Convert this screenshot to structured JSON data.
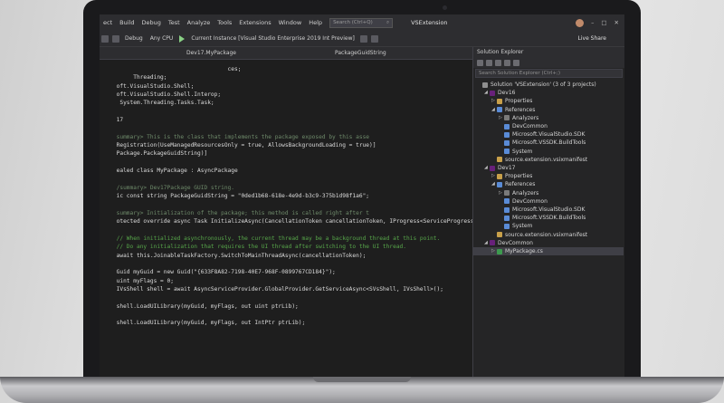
{
  "menu": {
    "items": [
      "ect",
      "Build",
      "Debug",
      "Test",
      "Analyze",
      "Tools",
      "Extensions",
      "Window",
      "Help"
    ],
    "search_placeholder": "Search (Ctrl+Q)",
    "solution_title": "VSExtension"
  },
  "toolbar": {
    "config": "Debug",
    "platform": "Any CPU",
    "run_target": "Current Instance [Visual Studio Enterprise 2019 Int Preview]",
    "live_share": "Live Share"
  },
  "editor_nav": {
    "class_dropdown": "Dev17.MyPackage",
    "member_dropdown": "PackageGuidString"
  },
  "code_lines": [
    "                                      ces;",
    "          Threading;",
    "     oft.VisualStudio.Shell;",
    "     oft.VisualStudio.Shell.Interop;",
    "      System.Threading.Tasks.Task;",
    "",
    "     17",
    "",
    "     summary> This is the class that implements the package exposed by this asse",
    "     Registration(UseManagedResourcesOnly = true, AllowsBackgroundLoading = true)]",
    "     Package.PackageGuidString)]",
    "",
    "     ealed class MyPackage : AsyncPackage",
    "",
    "     /summary> Dev17Package GUID string.",
    "     ic const string PackageGuidString = \"0ded1b68-618e-4e9d-b3c9-375b1d98f1a6\";",
    "",
    "     summary> Initialization of the package; this method is called right after t",
    "     otected override async Task InitializeAsync(CancellationToken cancellationToken, IProgress<ServiceProgressData> pr",
    "",
    "     // When initialized asynchronously, the current thread may be a background thread at this point.",
    "     // Do any initialization that requires the UI thread after switching to the UI thread.",
    "     await this.JoinableTaskFactory.SwitchToMainThreadAsync(cancellationToken);",
    "",
    "     Guid myGuid = new Guid(\"{633F8A82-7198-40E7-968F-0899767CD184}\");",
    "     uint myFlags = 0;",
    "     IVsShell shell = await AsyncServiceProvider.GlobalProvider.GetServiceAsync<SVsShell, IVsShell>();",
    "",
    "     shell.LoadUILibrary(myGuid, myFlags, out uint ptrLib);",
    "",
    "     shell.LoadUILibrary(myGuid, myFlags, out IntPtr ptrLib);"
  ],
  "explorer": {
    "title": "Solution Explorer",
    "search_placeholder": "Search Solution Explorer (Ctrl+;)",
    "nodes": [
      {
        "label": "Solution 'VSExtension' (3 of 3 projects)",
        "depth": 0,
        "arrow": "",
        "color": "#8f8f8f"
      },
      {
        "label": "Dev16",
        "depth": 1,
        "arrow": "◢",
        "color": "#68217a"
      },
      {
        "label": "Properties",
        "depth": 2,
        "arrow": "▷",
        "color": "#c8a04a"
      },
      {
        "label": "References",
        "depth": 2,
        "arrow": "◢",
        "color": "#5a8bd6"
      },
      {
        "label": "Analyzers",
        "depth": 3,
        "arrow": "▷",
        "color": "#7a7a7a"
      },
      {
        "label": "DevCommon",
        "depth": 3,
        "arrow": "",
        "color": "#5a8bd6"
      },
      {
        "label": "Microsoft.VisualStudio.SDK",
        "depth": 3,
        "arrow": "",
        "color": "#5a8bd6"
      },
      {
        "label": "Microsoft.VSSDK.BuildTools",
        "depth": 3,
        "arrow": "",
        "color": "#5a8bd6"
      },
      {
        "label": "System",
        "depth": 3,
        "arrow": "",
        "color": "#5a8bd6"
      },
      {
        "label": "source.extension.vsixmanifest",
        "depth": 2,
        "arrow": "",
        "color": "#c8a04a"
      },
      {
        "label": "Dev17",
        "depth": 1,
        "arrow": "◢",
        "color": "#68217a"
      },
      {
        "label": "Properties",
        "depth": 2,
        "arrow": "▷",
        "color": "#c8a04a"
      },
      {
        "label": "References",
        "depth": 2,
        "arrow": "◢",
        "color": "#5a8bd6"
      },
      {
        "label": "Analyzers",
        "depth": 3,
        "arrow": "▷",
        "color": "#7a7a7a"
      },
      {
        "label": "DevCommon",
        "depth": 3,
        "arrow": "",
        "color": "#5a8bd6"
      },
      {
        "label": "Microsoft.VisualStudio.SDK",
        "depth": 3,
        "arrow": "",
        "color": "#5a8bd6"
      },
      {
        "label": "Microsoft.VSSDK.BuildTools",
        "depth": 3,
        "arrow": "",
        "color": "#5a8bd6"
      },
      {
        "label": "System",
        "depth": 3,
        "arrow": "",
        "color": "#5a8bd6"
      },
      {
        "label": "source.extension.vsixmanifest",
        "depth": 2,
        "arrow": "",
        "color": "#c8a04a"
      },
      {
        "label": "DevCommon",
        "depth": 1,
        "arrow": "◢",
        "color": "#68217a"
      },
      {
        "label": "MyPackage.cs",
        "depth": 2,
        "arrow": "▷",
        "color": "#3c9a4e",
        "selected": true
      }
    ]
  }
}
